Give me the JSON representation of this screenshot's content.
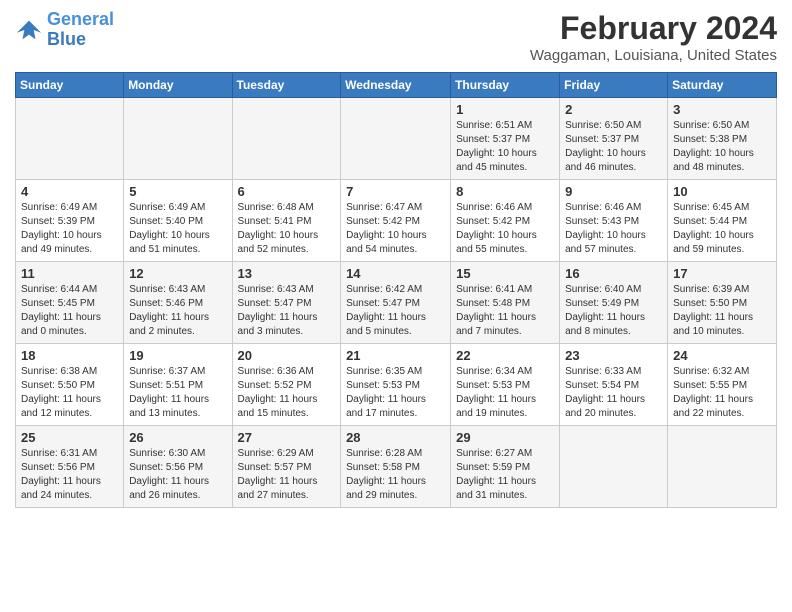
{
  "logo": {
    "line1": "General",
    "line2": "Blue"
  },
  "title": "February 2024",
  "subtitle": "Waggaman, Louisiana, United States",
  "weekdays": [
    "Sunday",
    "Monday",
    "Tuesday",
    "Wednesday",
    "Thursday",
    "Friday",
    "Saturday"
  ],
  "weeks": [
    [
      {
        "day": "",
        "sunrise": "",
        "sunset": "",
        "daylight": ""
      },
      {
        "day": "",
        "sunrise": "",
        "sunset": "",
        "daylight": ""
      },
      {
        "day": "",
        "sunrise": "",
        "sunset": "",
        "daylight": ""
      },
      {
        "day": "",
        "sunrise": "",
        "sunset": "",
        "daylight": ""
      },
      {
        "day": "1",
        "sunrise": "Sunrise: 6:51 AM",
        "sunset": "Sunset: 5:37 PM",
        "daylight": "Daylight: 10 hours and 45 minutes."
      },
      {
        "day": "2",
        "sunrise": "Sunrise: 6:50 AM",
        "sunset": "Sunset: 5:37 PM",
        "daylight": "Daylight: 10 hours and 46 minutes."
      },
      {
        "day": "3",
        "sunrise": "Sunrise: 6:50 AM",
        "sunset": "Sunset: 5:38 PM",
        "daylight": "Daylight: 10 hours and 48 minutes."
      }
    ],
    [
      {
        "day": "4",
        "sunrise": "Sunrise: 6:49 AM",
        "sunset": "Sunset: 5:39 PM",
        "daylight": "Daylight: 10 hours and 49 minutes."
      },
      {
        "day": "5",
        "sunrise": "Sunrise: 6:49 AM",
        "sunset": "Sunset: 5:40 PM",
        "daylight": "Daylight: 10 hours and 51 minutes."
      },
      {
        "day": "6",
        "sunrise": "Sunrise: 6:48 AM",
        "sunset": "Sunset: 5:41 PM",
        "daylight": "Daylight: 10 hours and 52 minutes."
      },
      {
        "day": "7",
        "sunrise": "Sunrise: 6:47 AM",
        "sunset": "Sunset: 5:42 PM",
        "daylight": "Daylight: 10 hours and 54 minutes."
      },
      {
        "day": "8",
        "sunrise": "Sunrise: 6:46 AM",
        "sunset": "Sunset: 5:42 PM",
        "daylight": "Daylight: 10 hours and 55 minutes."
      },
      {
        "day": "9",
        "sunrise": "Sunrise: 6:46 AM",
        "sunset": "Sunset: 5:43 PM",
        "daylight": "Daylight: 10 hours and 57 minutes."
      },
      {
        "day": "10",
        "sunrise": "Sunrise: 6:45 AM",
        "sunset": "Sunset: 5:44 PM",
        "daylight": "Daylight: 10 hours and 59 minutes."
      }
    ],
    [
      {
        "day": "11",
        "sunrise": "Sunrise: 6:44 AM",
        "sunset": "Sunset: 5:45 PM",
        "daylight": "Daylight: 11 hours and 0 minutes."
      },
      {
        "day": "12",
        "sunrise": "Sunrise: 6:43 AM",
        "sunset": "Sunset: 5:46 PM",
        "daylight": "Daylight: 11 hours and 2 minutes."
      },
      {
        "day": "13",
        "sunrise": "Sunrise: 6:43 AM",
        "sunset": "Sunset: 5:47 PM",
        "daylight": "Daylight: 11 hours and 3 minutes."
      },
      {
        "day": "14",
        "sunrise": "Sunrise: 6:42 AM",
        "sunset": "Sunset: 5:47 PM",
        "daylight": "Daylight: 11 hours and 5 minutes."
      },
      {
        "day": "15",
        "sunrise": "Sunrise: 6:41 AM",
        "sunset": "Sunset: 5:48 PM",
        "daylight": "Daylight: 11 hours and 7 minutes."
      },
      {
        "day": "16",
        "sunrise": "Sunrise: 6:40 AM",
        "sunset": "Sunset: 5:49 PM",
        "daylight": "Daylight: 11 hours and 8 minutes."
      },
      {
        "day": "17",
        "sunrise": "Sunrise: 6:39 AM",
        "sunset": "Sunset: 5:50 PM",
        "daylight": "Daylight: 11 hours and 10 minutes."
      }
    ],
    [
      {
        "day": "18",
        "sunrise": "Sunrise: 6:38 AM",
        "sunset": "Sunset: 5:50 PM",
        "daylight": "Daylight: 11 hours and 12 minutes."
      },
      {
        "day": "19",
        "sunrise": "Sunrise: 6:37 AM",
        "sunset": "Sunset: 5:51 PM",
        "daylight": "Daylight: 11 hours and 13 minutes."
      },
      {
        "day": "20",
        "sunrise": "Sunrise: 6:36 AM",
        "sunset": "Sunset: 5:52 PM",
        "daylight": "Daylight: 11 hours and 15 minutes."
      },
      {
        "day": "21",
        "sunrise": "Sunrise: 6:35 AM",
        "sunset": "Sunset: 5:53 PM",
        "daylight": "Daylight: 11 hours and 17 minutes."
      },
      {
        "day": "22",
        "sunrise": "Sunrise: 6:34 AM",
        "sunset": "Sunset: 5:53 PM",
        "daylight": "Daylight: 11 hours and 19 minutes."
      },
      {
        "day": "23",
        "sunrise": "Sunrise: 6:33 AM",
        "sunset": "Sunset: 5:54 PM",
        "daylight": "Daylight: 11 hours and 20 minutes."
      },
      {
        "day": "24",
        "sunrise": "Sunrise: 6:32 AM",
        "sunset": "Sunset: 5:55 PM",
        "daylight": "Daylight: 11 hours and 22 minutes."
      }
    ],
    [
      {
        "day": "25",
        "sunrise": "Sunrise: 6:31 AM",
        "sunset": "Sunset: 5:56 PM",
        "daylight": "Daylight: 11 hours and 24 minutes."
      },
      {
        "day": "26",
        "sunrise": "Sunrise: 6:30 AM",
        "sunset": "Sunset: 5:56 PM",
        "daylight": "Daylight: 11 hours and 26 minutes."
      },
      {
        "day": "27",
        "sunrise": "Sunrise: 6:29 AM",
        "sunset": "Sunset: 5:57 PM",
        "daylight": "Daylight: 11 hours and 27 minutes."
      },
      {
        "day": "28",
        "sunrise": "Sunrise: 6:28 AM",
        "sunset": "Sunset: 5:58 PM",
        "daylight": "Daylight: 11 hours and 29 minutes."
      },
      {
        "day": "29",
        "sunrise": "Sunrise: 6:27 AM",
        "sunset": "Sunset: 5:59 PM",
        "daylight": "Daylight: 11 hours and 31 minutes."
      },
      {
        "day": "",
        "sunrise": "",
        "sunset": "",
        "daylight": ""
      },
      {
        "day": "",
        "sunrise": "",
        "sunset": "",
        "daylight": ""
      }
    ]
  ]
}
